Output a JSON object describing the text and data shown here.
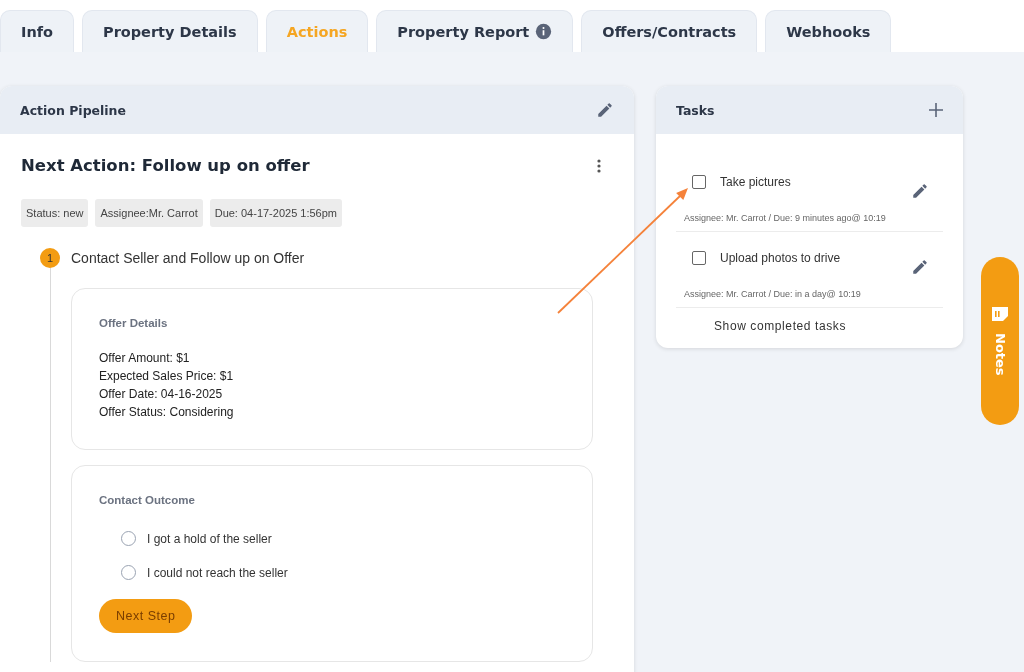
{
  "tabs": [
    {
      "label": "Info",
      "selected": false,
      "kind": "plain"
    },
    {
      "label": "Property Details",
      "selected": false,
      "kind": "plain"
    },
    {
      "label": "Actions",
      "selected": true,
      "kind": "plain"
    },
    {
      "label": "Property Report",
      "selected": false,
      "kind": "info"
    },
    {
      "label": "Offers/Contracts",
      "selected": false,
      "kind": "plain"
    },
    {
      "label": "Webhooks",
      "selected": false,
      "kind": "plain"
    }
  ],
  "action_pipeline": {
    "title": "Action Pipeline",
    "next_action": "Next Action: Follow up on offer",
    "chips": [
      "Status: new",
      "Assignee:Mr. Carrot",
      "Due: 04-17-2025 1:56pm"
    ],
    "step": {
      "number": "1",
      "title": "Contact Seller and Follow up on Offer"
    },
    "offer_details": {
      "heading": "Offer Details",
      "lines": [
        "Offer Amount: $1",
        "Expected Sales Price: $1",
        "Offer Date: 04-16-2025",
        "Offer Status: Considering"
      ]
    },
    "contact_outcome": {
      "heading": "Contact Outcome",
      "options": [
        {
          "label": "I got a hold of the seller",
          "selected": false
        },
        {
          "label": "I could not reach the seller",
          "selected": false
        }
      ],
      "button": "Next Step"
    }
  },
  "tasks": {
    "title": "Tasks",
    "items": [
      {
        "title": "Take pictures",
        "checked": false,
        "meta": "Assignee: Mr. Carrot / Due: 9 minutes ago@ 10:19"
      },
      {
        "title": "Upload photos to drive",
        "checked": false,
        "meta": "Assignee: Mr. Carrot / Due: in a day@ 10:19"
      }
    ],
    "footer_link": "Show completed tasks"
  },
  "notes_tab": {
    "label": "Notes"
  }
}
